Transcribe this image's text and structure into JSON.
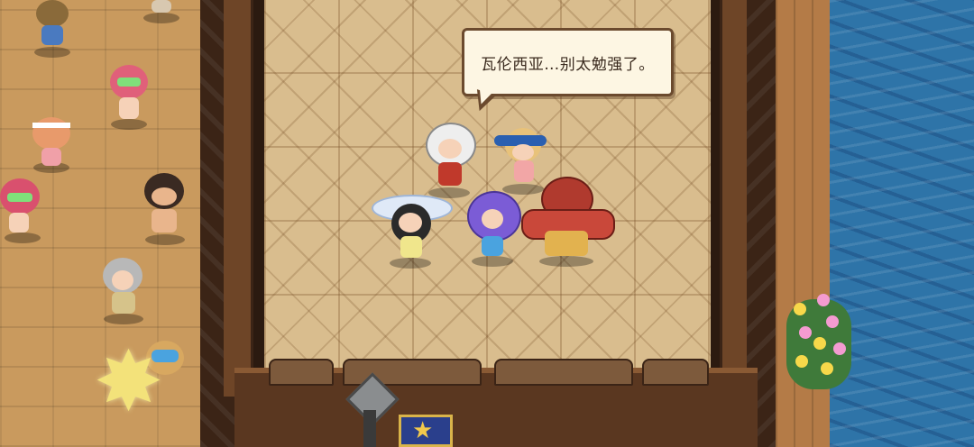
{
  "dialogue": {
    "text": "瓦伦西亚…别太勉强了。"
  },
  "characters": [
    {
      "name": "white-haired-girl",
      "hair": "#eeeeee",
      "outfit": "#c0392b"
    },
    {
      "name": "blue-visor-girl",
      "hair": "#e8c27a",
      "outfit": "#f2a6a6"
    },
    {
      "name": "white-hat-girl",
      "hair": "#2a2a2a",
      "outfit": "#f0e68c"
    },
    {
      "name": "purple-haired-girl",
      "hair": "#7b5cd6",
      "outfit": "#4aa3df"
    },
    {
      "name": "red-armored-brute",
      "hair": "#b03a2e",
      "outfit": "#e2b24f"
    }
  ],
  "spectators": [
    {
      "name": "spectator-sunglasses",
      "hair": "#8a6a3a"
    },
    {
      "name": "spectator-pink-hair-1",
      "hair": "#e0607a"
    },
    {
      "name": "spectator-headband",
      "hair": "#e89a6b"
    },
    {
      "name": "spectator-pink-hair-2",
      "hair": "#d9506e"
    },
    {
      "name": "spectator-goggles",
      "hair": "#3a2a22"
    },
    {
      "name": "spectator-grey-hair",
      "hair": "#b8b8b8"
    },
    {
      "name": "spectator-diver",
      "hair": "#d8a860"
    }
  ],
  "colors": {
    "wood": "#c99a5e",
    "arena_floor": "#d9bd8e",
    "water": "#2e74a8",
    "bubble_bg": "#fdf6e3",
    "bubble_border": "#6b4a2e"
  },
  "icons": {
    "star_decoration": "star-icon",
    "banner": "star-banner-icon"
  }
}
